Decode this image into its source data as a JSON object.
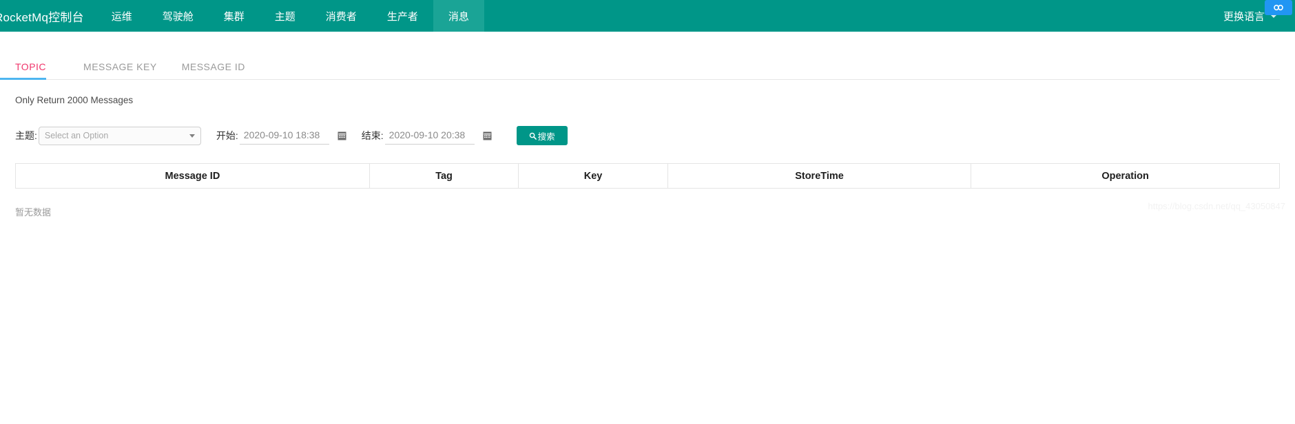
{
  "theme": {
    "nav_bg": "#009688",
    "nav_active_bg": "#1aa496",
    "tab_active_text": "#f0356b",
    "tab_active_underline": "#4db5f0",
    "button_bg": "#009688",
    "badge_bg": "#2196f3"
  },
  "navbar": {
    "brand": "RocketMq控制台",
    "items": [
      {
        "label": "运维",
        "active": false
      },
      {
        "label": "驾驶舱",
        "active": false
      },
      {
        "label": "集群",
        "active": false
      },
      {
        "label": "主题",
        "active": false
      },
      {
        "label": "消费者",
        "active": false
      },
      {
        "label": "生产者",
        "active": false
      },
      {
        "label": "消息",
        "active": true
      }
    ],
    "language_switch": "更换语言",
    "caret_icon": "chevron-down-icon",
    "corner_badge_icon": "infinity-icon"
  },
  "tabs": [
    {
      "label": "TOPIC",
      "active": true
    },
    {
      "label": "MESSAGE KEY",
      "active": false
    },
    {
      "label": "MESSAGE ID",
      "active": false
    }
  ],
  "notice": "Only Return 2000 Messages",
  "form": {
    "topic_label": "主题:",
    "topic_placeholder": "Select an Option",
    "topic_value": "",
    "begin_label": "开始:",
    "begin_value": "2020-09-10 18:38",
    "end_label": "结束:",
    "end_value": "2020-09-10 20:38",
    "calendar_icon": "calendar-icon",
    "search_icon": "search-icon",
    "search_label": "搜索"
  },
  "table": {
    "columns": [
      "Message ID",
      "Tag",
      "Key",
      "StoreTime",
      "Operation"
    ],
    "rows": [],
    "empty_text": "暂无数据"
  },
  "watermark": "https://blog.csdn.net/qq_43050847"
}
